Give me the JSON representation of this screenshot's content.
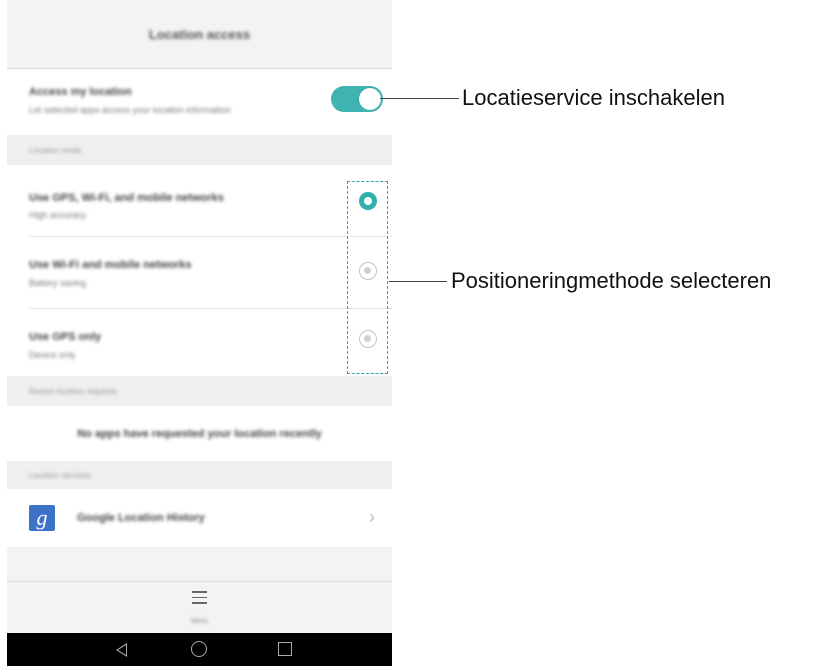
{
  "screen": {
    "title": "Location access",
    "access_row": {
      "title": "Access my location",
      "subtitle": "Let selected apps access your location information",
      "toggle_on": true
    },
    "location_mode_header": "Location mode",
    "modes": [
      {
        "title": "Use GPS, Wi-Fi, and mobile networks",
        "subtitle": "High accuracy",
        "selected": true
      },
      {
        "title": "Use Wi-Fi and mobile networks",
        "subtitle": "Battery saving",
        "selected": false
      },
      {
        "title": "Use GPS only",
        "subtitle": "Device only",
        "selected": false
      }
    ],
    "recent_requests_header": "Recent location requests",
    "recent_requests_empty": "No apps have requested your location recently",
    "location_services_header": "Location services",
    "google_item": {
      "icon": "google-g-icon",
      "label": "Google Location History"
    },
    "menu_label": "Menu"
  },
  "annotations": {
    "toggle_callout": "Locatieservice inschakelen",
    "mode_callout": "Positioneringmethode selecteren"
  },
  "colors": {
    "accent": "#2fb0ac",
    "dashed_box": "#2aa8a5",
    "google_icon_bg": "#3d72c9"
  }
}
